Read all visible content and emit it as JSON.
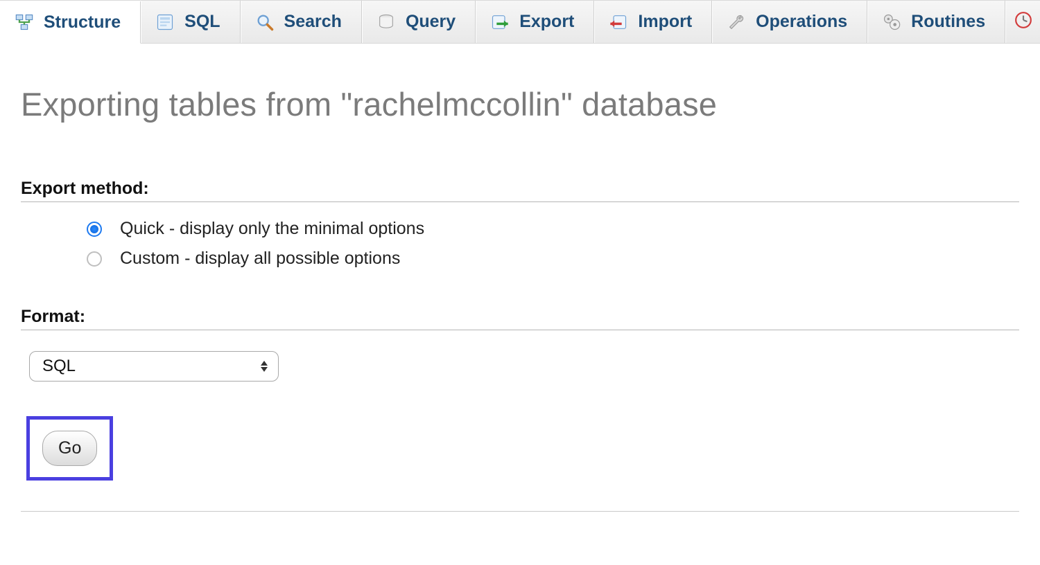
{
  "tabs": {
    "items": [
      {
        "label": "Structure",
        "icon": "structure-icon",
        "active": true
      },
      {
        "label": "SQL",
        "icon": "sql-icon",
        "active": false
      },
      {
        "label": "Search",
        "icon": "search-icon",
        "active": false
      },
      {
        "label": "Query",
        "icon": "query-icon",
        "active": false
      },
      {
        "label": "Export",
        "icon": "export-icon",
        "active": false
      },
      {
        "label": "Import",
        "icon": "import-icon",
        "active": false
      },
      {
        "label": "Operations",
        "icon": "operations-icon",
        "active": false
      },
      {
        "label": "Routines",
        "icon": "routines-icon",
        "active": false
      }
    ]
  },
  "page": {
    "title": "Exporting tables from \"rachelmccollin\" database"
  },
  "export_method": {
    "heading": "Export method:",
    "options": [
      {
        "label": "Quick - display only the minimal options",
        "selected": true
      },
      {
        "label": "Custom - display all possible options",
        "selected": false
      }
    ]
  },
  "format": {
    "heading": "Format:",
    "selected": "SQL"
  },
  "actions": {
    "go_label": "Go"
  }
}
